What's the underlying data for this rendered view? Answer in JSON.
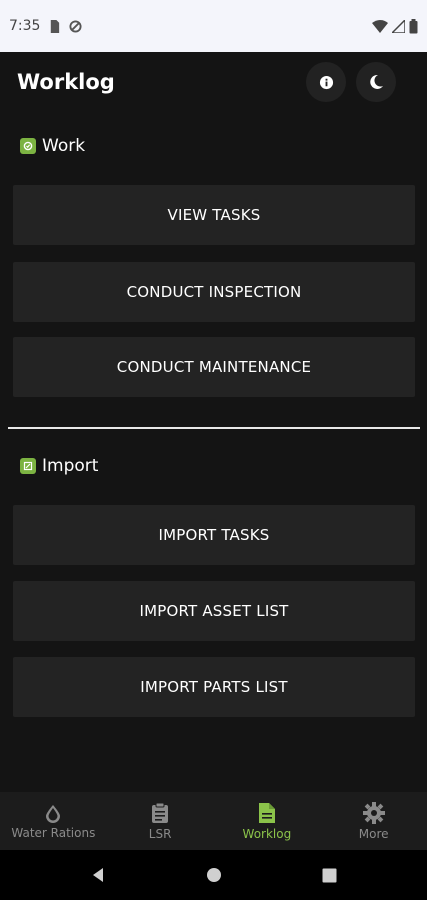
{
  "status_bar": {
    "time": "7:35",
    "icons": [
      "sim-card-icon",
      "data-saver-icon",
      "wifi-icon",
      "signal-icon",
      "battery-icon"
    ]
  },
  "header": {
    "title": "Worklog",
    "actions": [
      "info-icon",
      "dark-mode-icon"
    ]
  },
  "sections": {
    "work": {
      "title": "Work",
      "buttons": [
        "VIEW TASKS",
        "CONDUCT INSPECTION",
        "CONDUCT MAINTENANCE"
      ]
    },
    "import": {
      "title": "Import",
      "buttons": [
        "IMPORT TASKS",
        "IMPORT ASSET LIST",
        "IMPORT PARTS LIST"
      ]
    }
  },
  "bottom_nav": {
    "items": [
      {
        "label": "Water Rations",
        "icon": "water-drop-icon",
        "active": false
      },
      {
        "label": "LSR",
        "icon": "clipboard-icon",
        "active": false
      },
      {
        "label": "Worklog",
        "icon": "document-icon",
        "active": true
      },
      {
        "label": "More",
        "icon": "gear-icon",
        "active": false
      }
    ]
  },
  "colors": {
    "background": "#141414",
    "button": "#232323",
    "accent": "#8bc34a",
    "status_bar": "#f4f5fb"
  }
}
